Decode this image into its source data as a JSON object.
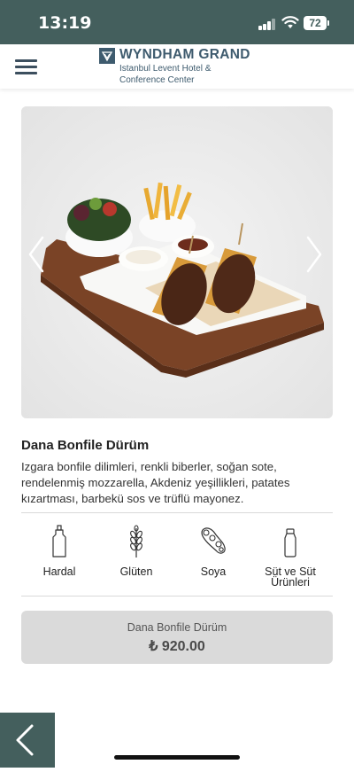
{
  "status_bar": {
    "time": "13:19",
    "battery": "72"
  },
  "header": {
    "brand": "WYNDHAM GRAND",
    "subtitle_line1": "Istanbul Levent Hotel &",
    "subtitle_line2": "Conference Center",
    "menu_icon": "hamburger-menu-icon"
  },
  "product": {
    "title": "Dana Bonfile Dürüm",
    "description": "Izgara bonfile dilimleri, renkli biberler, soğan sote, rendelenmiş mozzarella, Akdeniz yeşillikleri, patates kızartması, barbekü sos ve trüflü mayonez."
  },
  "carousel": {
    "prev_icon": "chevron-left-icon",
    "next_icon": "chevron-right-icon"
  },
  "allergens": [
    {
      "label": "Hardal",
      "icon": "mustard-bottle-icon"
    },
    {
      "label": "Glüten",
      "icon": "wheat-icon"
    },
    {
      "label": "Soya",
      "icon": "soybean-icon"
    },
    {
      "label_line1": "Süt ve Süt",
      "label_line2": "Ürünleri",
      "icon": "milk-bottle-icon"
    }
  ],
  "price_box": {
    "name": "Dana Bonfile Dürüm",
    "price": "₺ 920.00"
  },
  "nav": {
    "back_icon": "chevron-left-icon"
  },
  "colors": {
    "brand": "#3e5b6e",
    "status_bar": "#445f5d",
    "price_box": "#dadada"
  }
}
